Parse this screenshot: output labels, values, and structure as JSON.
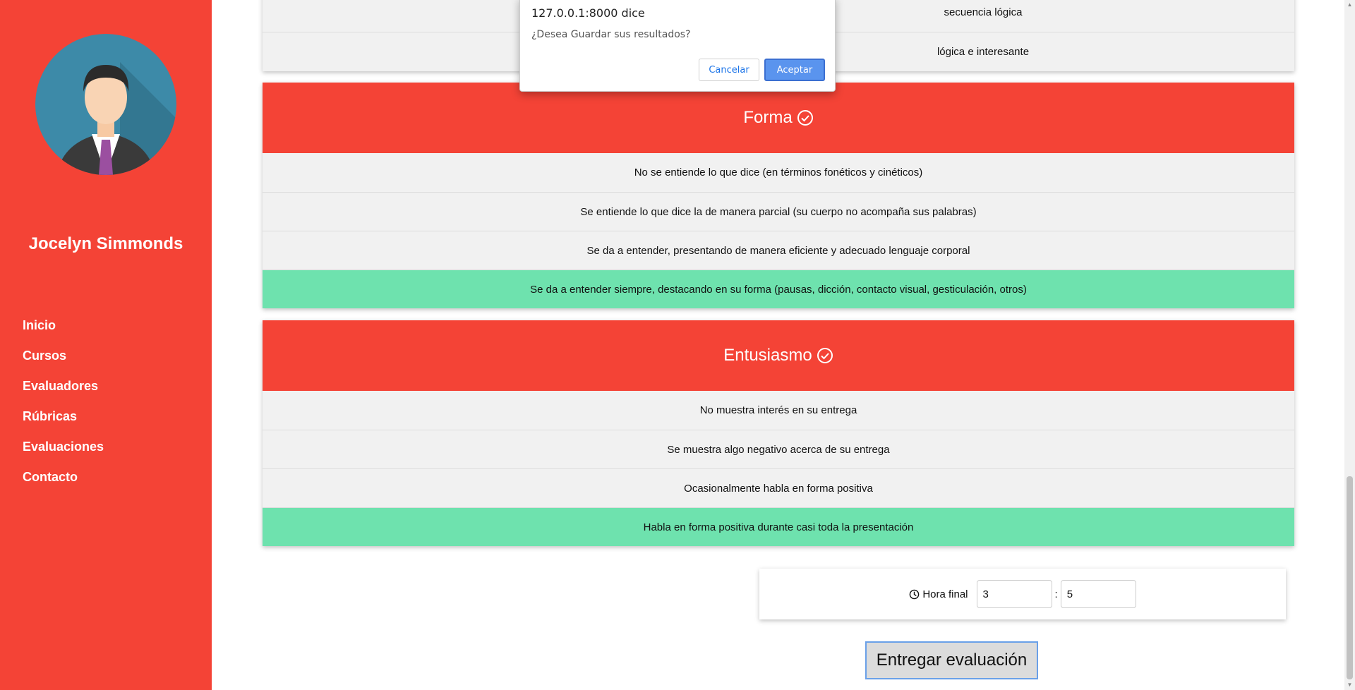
{
  "sidebar": {
    "user_name": "Jocelyn Simmonds",
    "nav": [
      "Inicio",
      "Cursos",
      "Evaluadores",
      "Rúbricas",
      "Evaluaciones",
      "Contacto"
    ]
  },
  "prev_card": {
    "rows": [
      "secuencia lógica",
      "lógica e interesante"
    ]
  },
  "forma": {
    "title": "Forma",
    "options": [
      "No se entiende lo que dice (en términos fonéticos y cinéticos)",
      "Se entiende lo que dice la de manera parcial (su cuerpo no acompaña sus palabras)",
      "Se da a entender, presentando de manera eficiente y adecuado lenguaje corporal",
      "Se da a entender siempre, destacando en su forma (pausas, dicción, contacto visual, gesticulación, otros)"
    ],
    "selected_index": 3
  },
  "entusiasmo": {
    "title": "Entusiasmo",
    "options": [
      "No muestra interés en su entrega",
      "Se muestra algo negativo acerca de su entrega",
      "Ocasionalmente habla en forma positiva",
      "Habla en forma positiva durante casi toda la presentación"
    ],
    "selected_index": 3
  },
  "time": {
    "label": "Hora final",
    "hour": "3",
    "minute": "5",
    "separator": ":"
  },
  "submit_label": "Entregar evaluación",
  "dialog": {
    "title": "127.0.0.1:8000 dice",
    "message": "¿Desea Guardar sus resultados?",
    "cancel_label": "Cancelar",
    "ok_label": "Aceptar"
  },
  "colors": {
    "sidebar": "#f44336",
    "header": "#f44336",
    "selected": "#6ee2ae"
  }
}
